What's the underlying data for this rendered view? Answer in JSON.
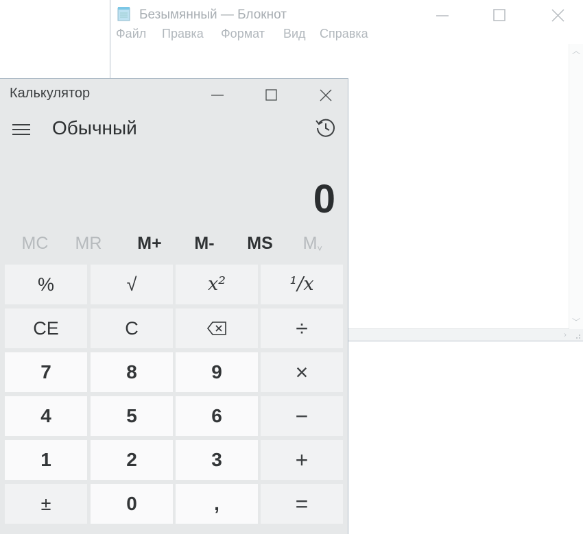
{
  "notepad": {
    "title": "Безымянный — Блокнот",
    "menu": [
      "Файл",
      "Правка",
      "Формат",
      "Вид",
      "Справка"
    ],
    "content": ""
  },
  "calculator": {
    "title": "Калькулятор",
    "mode": "Обычный",
    "display": "0",
    "memory": [
      "MC",
      "MR",
      "M+",
      "M-",
      "MS",
      "M"
    ],
    "memory_enabled": [
      false,
      false,
      true,
      true,
      true,
      false
    ],
    "keys": [
      [
        "%",
        "√",
        "x²",
        "¹/x"
      ],
      [
        "CE",
        "C",
        "⌫",
        "÷"
      ],
      [
        "7",
        "8",
        "9",
        "×"
      ],
      [
        "4",
        "5",
        "6",
        "−"
      ],
      [
        "1",
        "2",
        "3",
        "+"
      ],
      [
        "±",
        "0",
        ",",
        "="
      ]
    ]
  },
  "icons": {
    "notepad_app": "notepad-icon",
    "menu": "hamburger-icon",
    "history": "history-icon",
    "backspace": "backspace-icon"
  },
  "colors": {
    "calc_bg": "#e6e8e9",
    "key_fn": "#f1f2f3",
    "key_num": "#fafafb",
    "text_dark": "#2d3032",
    "text_disabled": "#b6babd",
    "notepad_inactive_text": "#a8aeb3"
  }
}
